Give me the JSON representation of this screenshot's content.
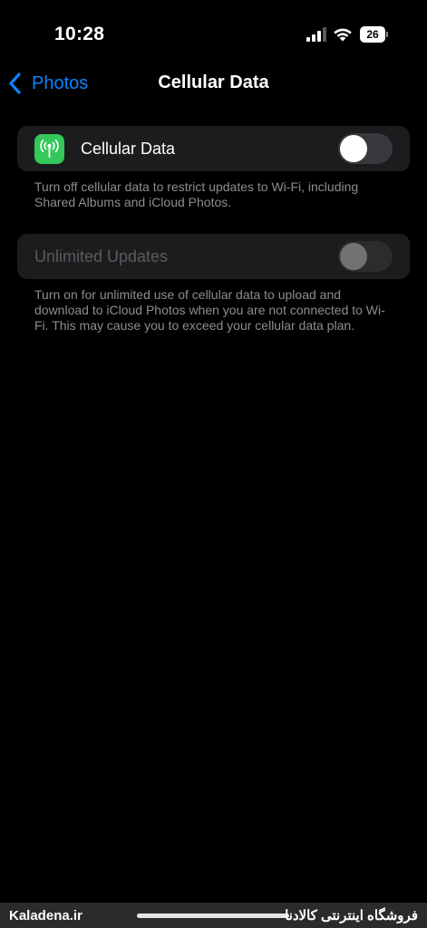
{
  "status_bar": {
    "time": "10:28",
    "battery_level": "26",
    "signal_icon": "cellular-signal-icon",
    "wifi_icon": "wifi-icon"
  },
  "nav": {
    "back_label": "Photos",
    "title": "Cellular Data"
  },
  "cellular_data": {
    "label": "Cellular Data",
    "icon": "antenna-icon",
    "icon_color": "#34c759",
    "enabled": false,
    "footer": "Turn off cellular data to restrict updates to Wi-Fi, including Shared Albums and iCloud Photos."
  },
  "unlimited_updates": {
    "label": "Unlimited Updates",
    "enabled": false,
    "disabled": true,
    "footer": "Turn on for unlimited use of cellular data to upload and download to iCloud Photos when you are not connected to Wi-Fi. This may cause you to exceed your cellular data plan."
  },
  "banner": {
    "left_text": "Kaladena.ir",
    "right_text": "فروشگاه اینترنتی کالادنا"
  },
  "colors": {
    "accent": "#0a84ff",
    "background": "#000000",
    "cell_background": "#1c1c1e"
  }
}
